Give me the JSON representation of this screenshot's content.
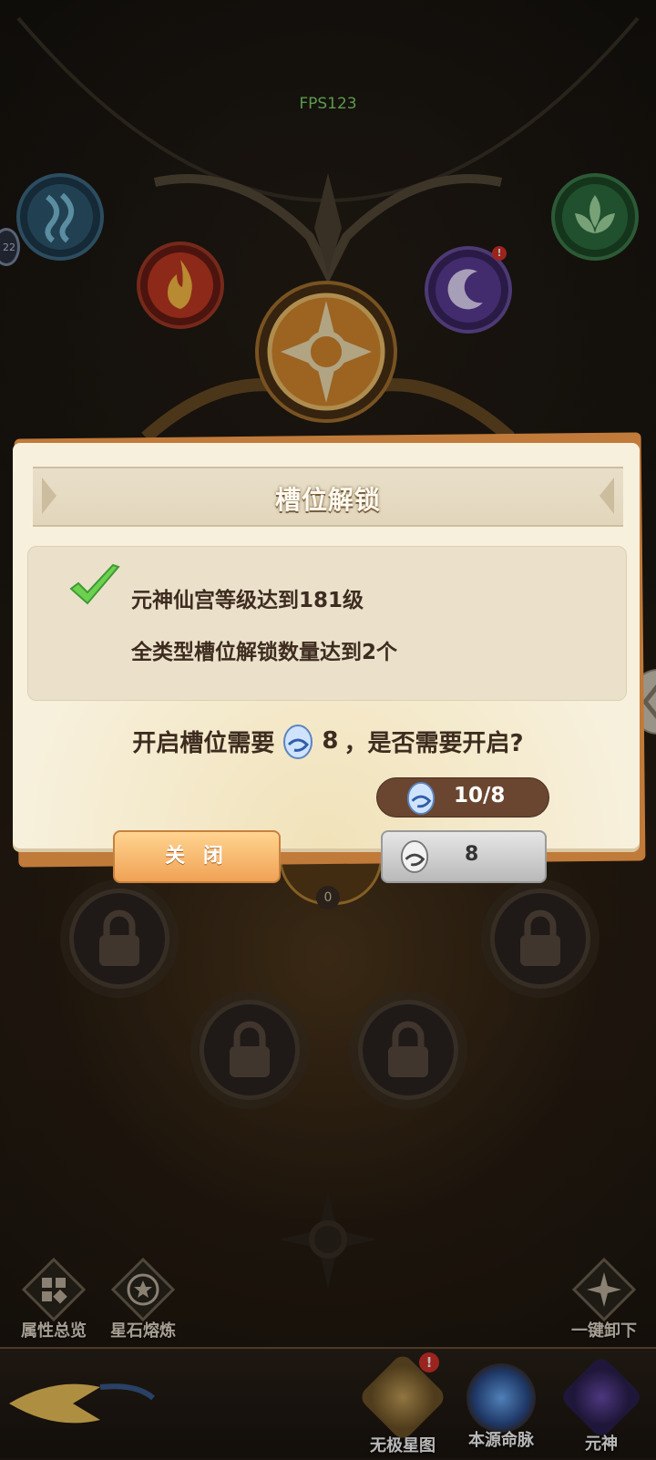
{
  "hud": {
    "fps": "FPS123",
    "side_badge": "22"
  },
  "element_orbs": [
    {
      "name": "water",
      "color": "#4a7b9c"
    },
    {
      "name": "fire",
      "color": "#e0582a"
    },
    {
      "name": "sun",
      "color": "#e39a34"
    },
    {
      "name": "moon",
      "color": "#7a5ab8"
    },
    {
      "name": "lotus",
      "color": "#3e8e4e"
    }
  ],
  "slot_dialog": {
    "title": "槽位解锁",
    "conditions": [
      "元神仙宫等级达到181级",
      "全类型槽位解锁数量达到2个"
    ],
    "question_prefix": "开启槽位需要",
    "question_amount": "8",
    "question_suffix": "，是否需要开启?",
    "owned": "10/8",
    "close_label": "关 闭",
    "open_cost": "8"
  },
  "slots": {
    "center_count": "0"
  },
  "side_actions": {
    "overview": "属性总览",
    "smelt": "星石熔炼",
    "unequip_all": "一键卸下"
  },
  "tabs": [
    {
      "label": "无极星图",
      "badge": "!"
    },
    {
      "label": "本源命脉"
    },
    {
      "label": "元神"
    }
  ],
  "colors": {
    "accent": "#f0a255",
    "brown_text": "#3d2c1f"
  }
}
